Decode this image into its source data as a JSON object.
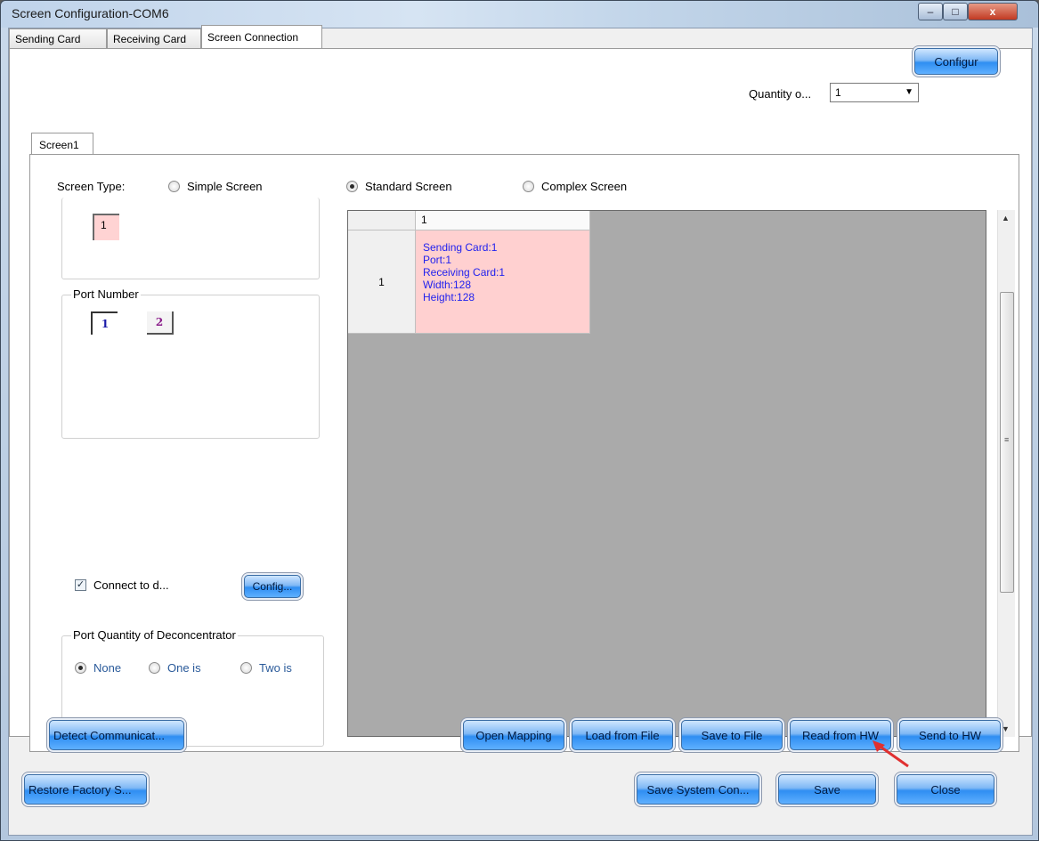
{
  "window": {
    "title": "Screen Configuration-COM6"
  },
  "caption_buttons": {
    "minimize": "–",
    "maximize": "□",
    "close": "x"
  },
  "top_tabs": [
    {
      "label": "Sending Card"
    },
    {
      "label": "Receiving Card"
    },
    {
      "label": "Screen Connection",
      "active": true
    }
  ],
  "quantity": {
    "label": "Quantity o...",
    "value": "1",
    "dropdown_arrow": "▼"
  },
  "configur_button": "Configur",
  "screen_tabs": [
    {
      "label": "Screen1",
      "active": true
    }
  ],
  "screen_type": {
    "label": "Screen Type:",
    "options": [
      {
        "label": "Simple Screen",
        "selected": false
      },
      {
        "label": "Standard Screen",
        "selected": true
      },
      {
        "label": "Complex Screen",
        "selected": false
      }
    ]
  },
  "receiving_card_box": "1",
  "port_number": {
    "label": "Port Number",
    "ports": [
      "1",
      "2"
    ]
  },
  "connect": {
    "label": "Connect to d...",
    "checked": true,
    "check_mark": "✓",
    "config_button": "Config..."
  },
  "deconcentrator": {
    "label": "Port Quantity of Deconcentrator",
    "options": [
      {
        "label": "None",
        "selected": true
      },
      {
        "label": "One is",
        "selected": false
      },
      {
        "label": "Two is",
        "selected": false
      }
    ]
  },
  "grid": {
    "column_header": "1",
    "row_header": "1",
    "cell_lines": [
      "Sending Card:1",
      "Port:1",
      "Receiving Card:1",
      "Width:128",
      "Height:128"
    ]
  },
  "scrollbar": {
    "up": "▲",
    "down": "▼",
    "grip": "≡"
  },
  "bottom_row1": {
    "detect": "Detect Communicat...",
    "open_mapping": "Open Mapping",
    "load_from_file": "Load from File",
    "save_to_file": "Save to File",
    "read_from_hw": "Read from HW",
    "send_to_hw": "Send to HW"
  },
  "bottom_row2": {
    "restore": "Restore Factory S...",
    "save_system": "Save System Con...",
    "save": "Save",
    "close": "Close"
  },
  "colors": {
    "button_blue": "#2f8ef2",
    "cell_pink": "#ffd0d0",
    "cell_text": "#2222ee",
    "arrow_red": "#e03030"
  }
}
